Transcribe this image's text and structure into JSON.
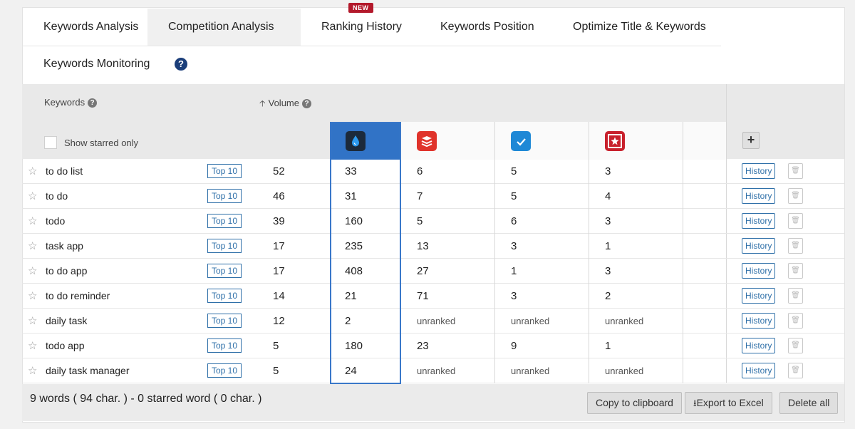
{
  "tabs": [
    {
      "label": "Keywords Analysis"
    },
    {
      "label": "Competition Analysis",
      "help": "?"
    },
    {
      "label": "Ranking History",
      "badge": "NEW"
    },
    {
      "label": "Keywords Position"
    },
    {
      "label": "Optimize Title & Keywords"
    },
    {
      "label": "Keywords Monitoring"
    }
  ],
  "header": {
    "keywords_label": "Keywords",
    "volume_label": "Volume",
    "help": "?",
    "sort_arrow": "🡡",
    "show_starred_label": "Show starred only",
    "add_symbol": "+"
  },
  "apps": [
    {
      "icon": "water-drop-app-icon",
      "color": "#1c2a3b"
    },
    {
      "icon": "layers-app-icon",
      "color": "#e0332b"
    },
    {
      "icon": "checkmark-app-icon",
      "color": "#1e88d6"
    },
    {
      "icon": "star-app-icon",
      "color": "#c8202c"
    }
  ],
  "row_labels": {
    "top10": "Top 10",
    "history": "History",
    "star": "☆",
    "trash": "🗑"
  },
  "rows": [
    {
      "keyword": "to do list",
      "volume": "52",
      "ranks": [
        "33",
        "6",
        "5",
        "3"
      ]
    },
    {
      "keyword": "to do",
      "volume": "46",
      "ranks": [
        "31",
        "7",
        "5",
        "4"
      ]
    },
    {
      "keyword": "todo",
      "volume": "39",
      "ranks": [
        "160",
        "5",
        "6",
        "3"
      ]
    },
    {
      "keyword": "task app",
      "volume": "17",
      "ranks": [
        "235",
        "13",
        "3",
        "1"
      ]
    },
    {
      "keyword": "to do app",
      "volume": "17",
      "ranks": [
        "408",
        "27",
        "1",
        "3"
      ]
    },
    {
      "keyword": "to do reminder",
      "volume": "14",
      "ranks": [
        "21",
        "71",
        "3",
        "2"
      ]
    },
    {
      "keyword": "daily task",
      "volume": "12",
      "ranks": [
        "2",
        "unranked",
        "unranked",
        "unranked"
      ]
    },
    {
      "keyword": "todo app",
      "volume": "5",
      "ranks": [
        "180",
        "23",
        "9",
        "1"
      ]
    },
    {
      "keyword": "daily task manager",
      "volume": "5",
      "ranks": [
        "24",
        "unranked",
        "unranked",
        "unranked"
      ]
    }
  ],
  "footer": {
    "summary": "9 words ( 94 char. ) - 0 starred word ( 0 char. )",
    "copy_label": "Copy to clipboard",
    "export_label": "Export to Excel",
    "delete_label": "Delete all"
  }
}
